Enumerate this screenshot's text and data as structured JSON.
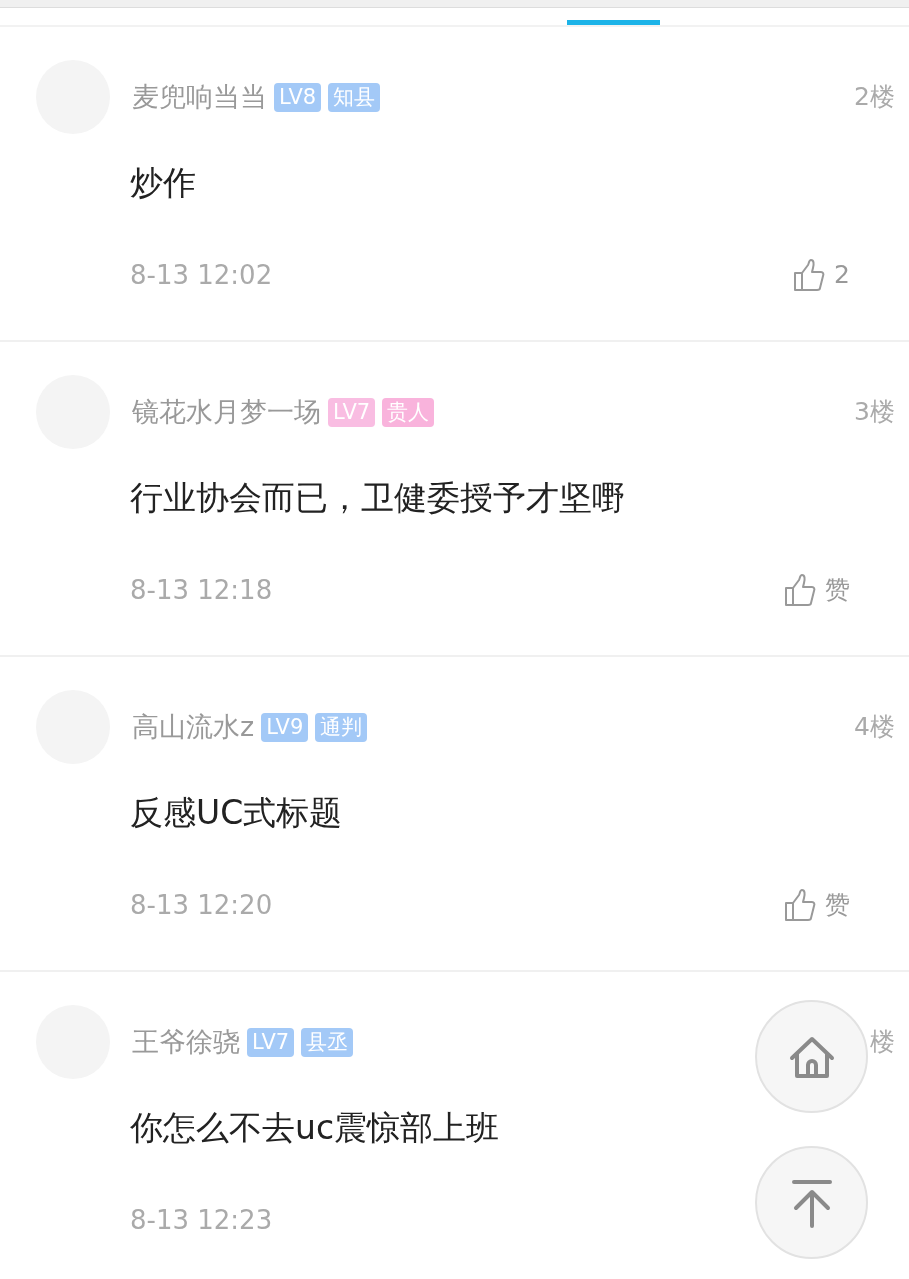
{
  "tab_indicator": {
    "selected": true
  },
  "comments": [
    {
      "user": "麦兜响当当",
      "badges": [
        {
          "label": "LV8",
          "color": "#a3c9f7"
        },
        {
          "label": "知县",
          "color": "#a3c9f7"
        }
      ],
      "floor": "2楼",
      "content": "炒作",
      "time": "8-13 12:02",
      "like": "2"
    },
    {
      "user": "镜花水月梦一场",
      "badges": [
        {
          "label": "LV7",
          "color": "#f9bde2"
        },
        {
          "label": "贵人",
          "color": "#f9b3dc"
        }
      ],
      "floor": "3楼",
      "content": "行业协会而已，卫健委授予才坚嘢",
      "time": "8-13 12:18",
      "like": "赞"
    },
    {
      "user": "高山流水z",
      "badges": [
        {
          "label": "LV9",
          "color": "#a3c9f7"
        },
        {
          "label": "通判",
          "color": "#a3c9f7"
        }
      ],
      "floor": "4楼",
      "content": "反感UC式标题",
      "time": "8-13 12:20",
      "like": "赞"
    },
    {
      "user": "王爷徐骁",
      "badges": [
        {
          "label": "LV7",
          "color": "#a3c9f7"
        },
        {
          "label": "县丞",
          "color": "#a3c9f7"
        }
      ],
      "floor": "楼",
      "content": "你怎么不去uc震惊部上班",
      "time": "8-13 12:23"
    }
  ],
  "floating_buttons": [
    {
      "kind": "home"
    },
    {
      "kind": "top"
    }
  ]
}
